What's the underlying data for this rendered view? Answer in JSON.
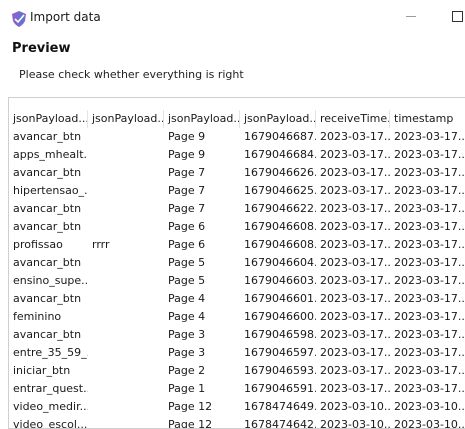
{
  "window": {
    "title": "Import data",
    "app_icon": "shield-database-icon",
    "minimize_icon": "minimize-icon",
    "maximize_icon": "maximize-icon"
  },
  "preview": {
    "title": "Preview",
    "subtitle": "Please check whether everything is right"
  },
  "table": {
    "columns": [
      "jsonPayload....",
      "jsonPayload....",
      "jsonPayload....",
      "jsonPayload....",
      "receiveTime...",
      "timestamp"
    ],
    "rows": [
      [
        "avancar_btn",
        "",
        "Page 9",
        "1679046687...",
        "2023-03-17...",
        "2023-03-17..."
      ],
      [
        "apps_mhealt...",
        "",
        "Page 9",
        "1679046684...",
        "2023-03-17...",
        "2023-03-17..."
      ],
      [
        "avancar_btn",
        "",
        "Page 7",
        "1679046626...",
        "2023-03-17...",
        "2023-03-17..."
      ],
      [
        "hipertensao_...",
        "",
        "Page 7",
        "1679046625...",
        "2023-03-17...",
        "2023-03-17..."
      ],
      [
        "avancar_btn",
        "",
        "Page 7",
        "1679046622...",
        "2023-03-17...",
        "2023-03-17..."
      ],
      [
        "avancar_btn",
        "",
        "Page 6",
        "1679046608...",
        "2023-03-17...",
        "2023-03-17..."
      ],
      [
        "profissao",
        "rrrr",
        "Page 6",
        "1679046608...",
        "2023-03-17...",
        "2023-03-17..."
      ],
      [
        "avancar_btn",
        "",
        "Page 5",
        "1679046604...",
        "2023-03-17...",
        "2023-03-17..."
      ],
      [
        "ensino_supe...",
        "",
        "Page 5",
        "1679046603...",
        "2023-03-17...",
        "2023-03-17..."
      ],
      [
        "avancar_btn",
        "",
        "Page 4",
        "1679046601...",
        "2023-03-17...",
        "2023-03-17..."
      ],
      [
        "feminino",
        "",
        "Page 4",
        "1679046600...",
        "2023-03-17...",
        "2023-03-17..."
      ],
      [
        "avancar_btn",
        "",
        "Page 3",
        "1679046598...",
        "2023-03-17...",
        "2023-03-17..."
      ],
      [
        "entre_35_59_...",
        "",
        "Page 3",
        "1679046597...",
        "2023-03-17...",
        "2023-03-17..."
      ],
      [
        "iniciar_btn",
        "",
        "Page 2",
        "1679046593...",
        "2023-03-17...",
        "2023-03-17..."
      ],
      [
        "entrar_quest...",
        "",
        "Page 1",
        "1679046591...",
        "2023-03-17...",
        "2023-03-17..."
      ],
      [
        "video_medir...",
        "",
        "Page 12",
        "1678474649...",
        "2023-03-10...",
        "2023-03-10..."
      ],
      [
        "video_escol...",
        "",
        "Page 12",
        "1678474642...",
        "2023-03-10...",
        "2023-03-10..."
      ]
    ]
  },
  "colors": {
    "icon_blue": "#4a7fd6",
    "icon_purple": "#8a63c9",
    "border": "#cfcfcf"
  }
}
